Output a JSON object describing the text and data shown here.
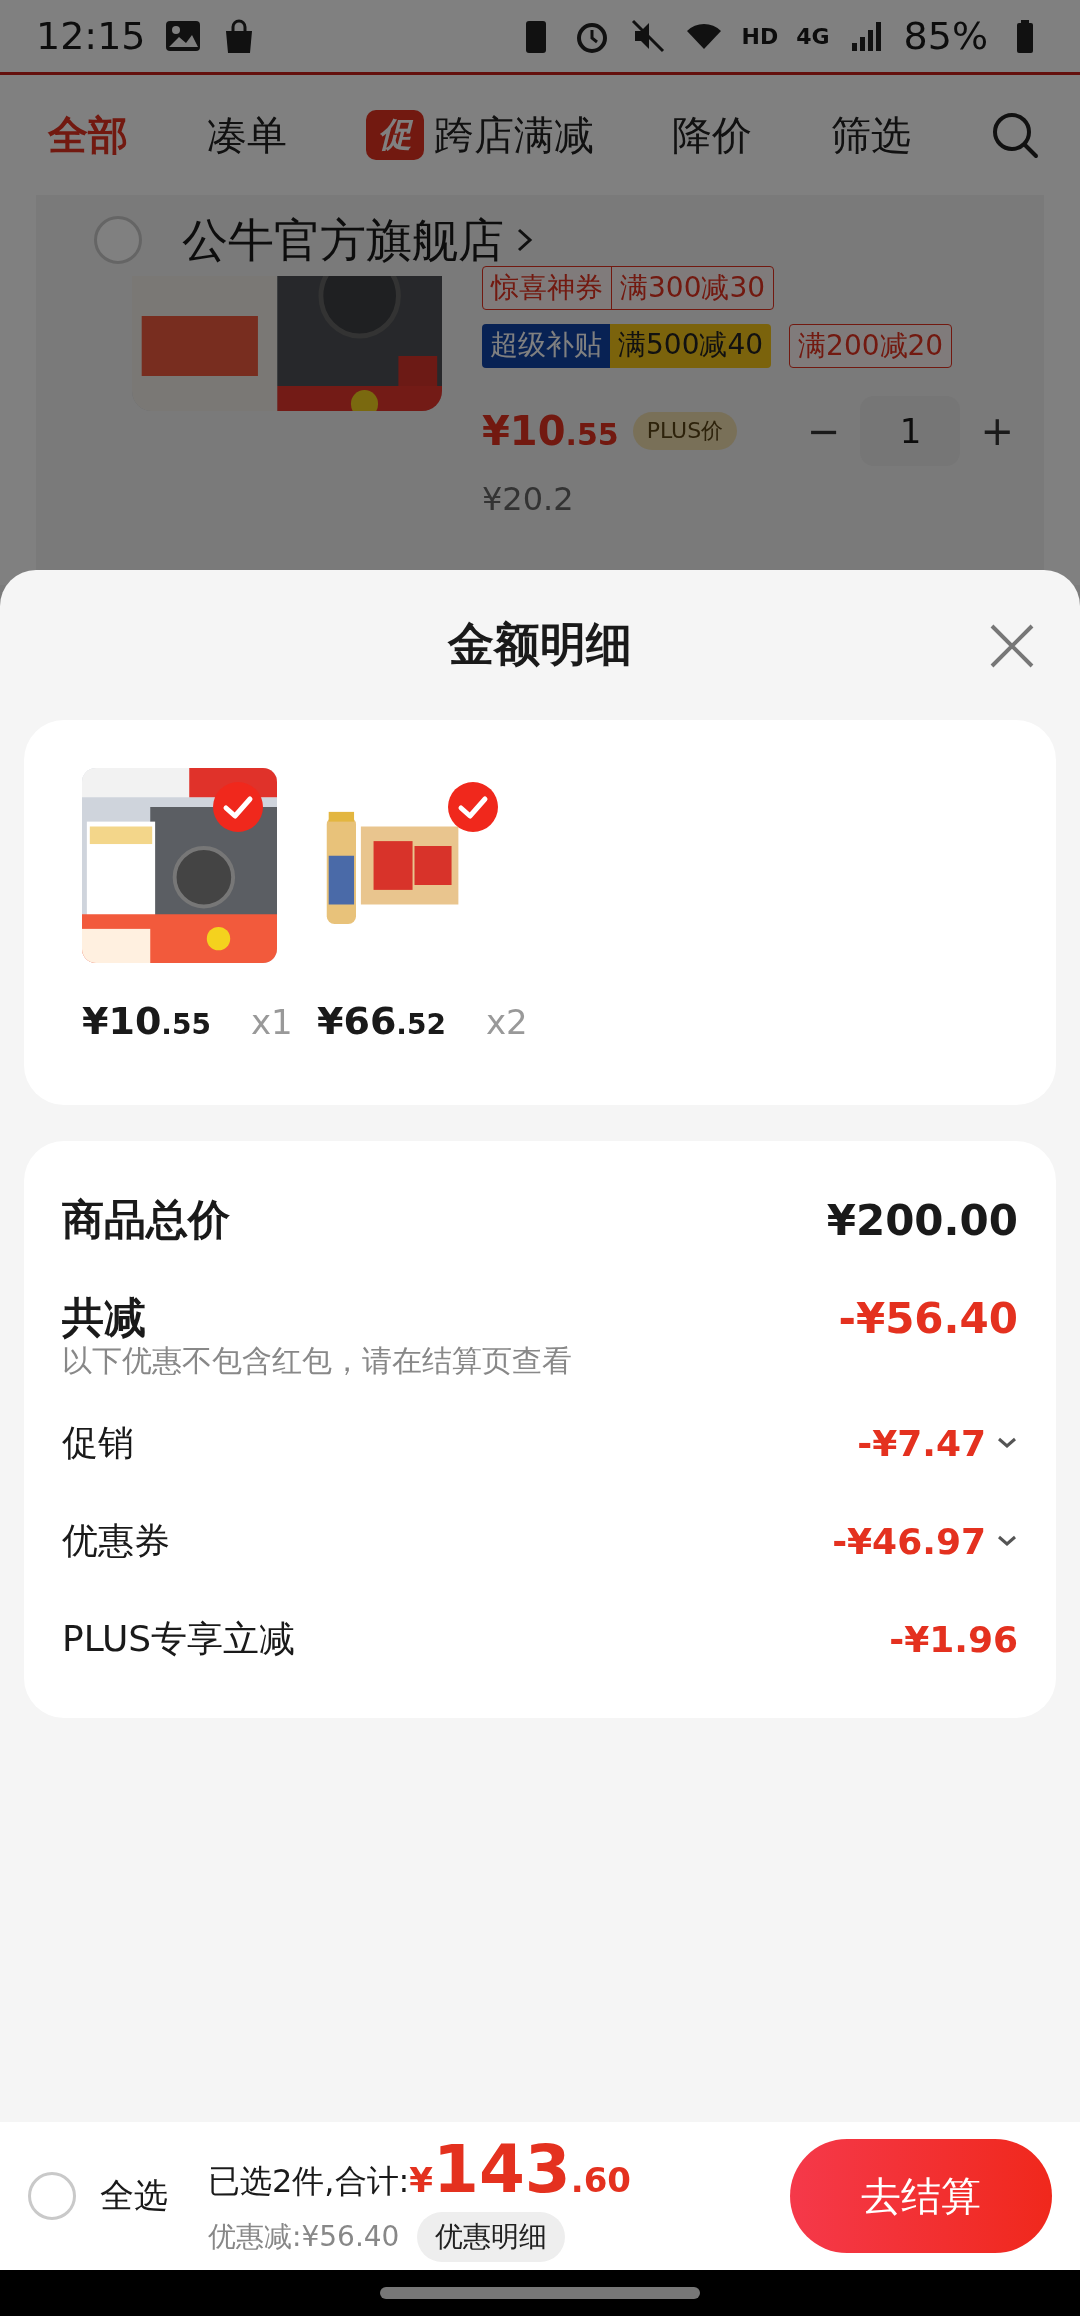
{
  "status_bar": {
    "time": "12:15",
    "hd": "HD",
    "network": "4G",
    "battery": "85%"
  },
  "tabs": [
    {
      "label": "全部",
      "selected": true
    },
    {
      "label": "凑单",
      "selected": false
    },
    {
      "label": "跨店满减",
      "selected": false,
      "badge": "促"
    },
    {
      "label": "降价",
      "selected": false
    },
    {
      "label": "筛选",
      "selected": false
    }
  ],
  "store": {
    "name": "公牛官方旗舰店",
    "checked": false,
    "item": {
      "kind": "picture",
      "tag_rows": [
        [
          {
            "kind": "coupon",
            "label": "惊喜神券",
            "value": "满300减30"
          }
        ],
        [
          {
            "kind": "subsidy",
            "label": "超级补贴",
            "value": "满500减40"
          },
          {
            "kind": "plain",
            "value": "满200减20"
          }
        ]
      ],
      "price_main": "¥10",
      "price_decimal": ".55",
      "plus_label": "PLUS价",
      "quantity": "1",
      "minus": "−",
      "plus": "+",
      "original_price": "¥20.2"
    }
  },
  "sheet": {
    "title": "金额明细",
    "products": [
      {
        "kind": "picture",
        "checked": true,
        "price_main": "¥10",
        "price_decimal": ".55",
        "quantity": "x1"
      },
      {
        "kind": "picture",
        "checked": true,
        "price_main": "¥66",
        "price_decimal": ".52",
        "quantity": "x2"
      }
    ],
    "summary": [
      {
        "kind": "total",
        "label": "商品总价",
        "value": "¥200.00"
      },
      {
        "kind": "discount",
        "label": "共减",
        "value": "-¥56.40",
        "note": "以下优惠不包含红包，请在结算页查看"
      },
      {
        "kind": "detail",
        "label": "促销",
        "value": "-¥7.47",
        "expandable": true
      },
      {
        "kind": "detail",
        "label": "优惠券",
        "value": "-¥46.97",
        "expandable": true
      },
      {
        "kind": "detail",
        "label": "PLUS专享立减",
        "value": "-¥1.96",
        "expandable": false
      }
    ]
  },
  "bottom_bar": {
    "select_all": {
      "label": "全选",
      "checked": false
    },
    "selected_text": "已选2件,合计:",
    "total_symbol": "¥",
    "total_main": "143",
    "total_decimal": ".60",
    "saving": "优惠减:¥56.40",
    "detail_button": "优惠明细",
    "checkout": "去结算"
  }
}
